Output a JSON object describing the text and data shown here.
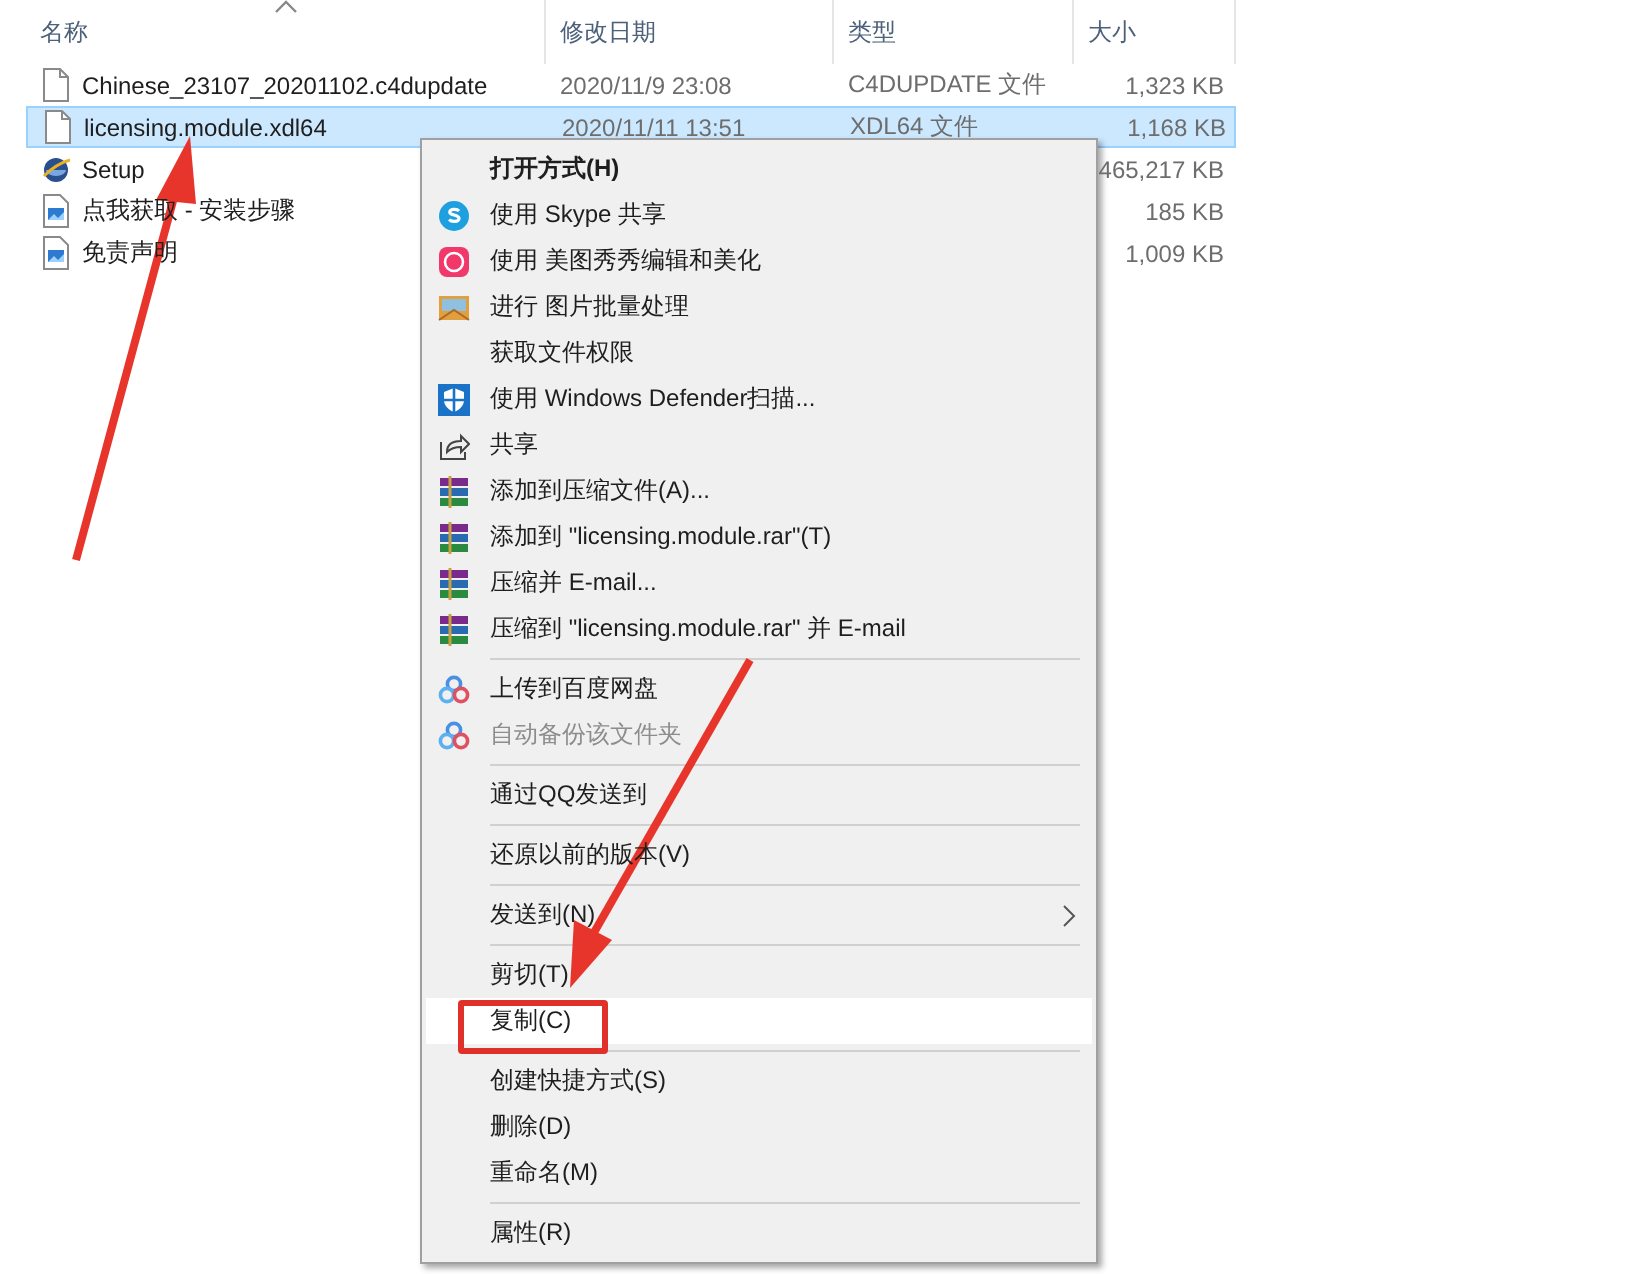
{
  "file_list": {
    "columns": [
      {
        "label": "名称",
        "sorted": true
      },
      {
        "label": "修改日期",
        "sorted": false
      },
      {
        "label": "类型",
        "sorted": false
      },
      {
        "label": "大小",
        "sorted": false
      }
    ],
    "files": [
      {
        "name": "Chinese_23107_20201102.c4dupdate",
        "kind": "document",
        "date": "2020/11/9 23:08",
        "type": "C4DUPDATE 文件",
        "size": "1,323 KB",
        "selected": false
      },
      {
        "name": "licensing.module.xdl64",
        "kind": "document",
        "date": "2020/11/11 13:51",
        "type": "XDL64 文件",
        "size": "1,168 KB",
        "selected": true
      },
      {
        "name": "Setup",
        "kind": "program",
        "size": "465,217 KB",
        "selected": false
      },
      {
        "name": "点我获取 - 安装步骤",
        "kind": "image",
        "size": "185 KB",
        "selected": false
      },
      {
        "name": "免责声明",
        "kind": "image",
        "size": "1,009 KB",
        "selected": false
      }
    ]
  },
  "context_menu": {
    "items": [
      {
        "kind": "item",
        "label": "打开方式(H)",
        "bold": true,
        "selected": false
      },
      {
        "kind": "item",
        "label": "使用 Skype 共享",
        "selected": false
      },
      {
        "kind": "item",
        "label": "使用 美图秀秀编辑和美化",
        "selected": false
      },
      {
        "kind": "item",
        "label": "进行 图片批量处理",
        "selected": false
      },
      {
        "kind": "item",
        "label": "获取文件权限",
        "selected": false
      },
      {
        "kind": "item",
        "label": "使用 Windows Defender扫描...",
        "selected": false
      },
      {
        "kind": "item",
        "label": "共享",
        "selected": false
      },
      {
        "kind": "item",
        "label": "添加到压缩文件(A)...",
        "selected": false
      },
      {
        "kind": "item",
        "label": "添加到 \"licensing.module.rar\"(T)",
        "selected": false
      },
      {
        "kind": "item",
        "label": "压缩并 E-mail...",
        "selected": false
      },
      {
        "kind": "item",
        "label": "压缩到 \"licensing.module.rar\" 并 E-mail",
        "selected": false
      },
      {
        "kind": "separator"
      },
      {
        "kind": "item",
        "label": "上传到百度网盘",
        "selected": false
      },
      {
        "kind": "item",
        "label": "自动备份该文件夹",
        "disabled": true,
        "selected": false
      },
      {
        "kind": "separator"
      },
      {
        "kind": "item",
        "label": "通过QQ发送到",
        "selected": false
      },
      {
        "kind": "separator"
      },
      {
        "kind": "item",
        "label": "还原以前的版本(V)",
        "selected": false
      },
      {
        "kind": "separator"
      },
      {
        "kind": "item",
        "label": "发送到(N)",
        "submenu": true,
        "selected": false
      },
      {
        "kind": "separator"
      },
      {
        "kind": "item",
        "label": "剪切(T)",
        "selected": false
      },
      {
        "kind": "item",
        "label": "复制(C)",
        "selected": true
      },
      {
        "kind": "separator"
      },
      {
        "kind": "item",
        "label": "创建快捷方式(S)",
        "selected": false
      },
      {
        "kind": "item",
        "label": "删除(D)",
        "selected": false
      },
      {
        "kind": "item",
        "label": "重命名(M)",
        "selected": false
      },
      {
        "kind": "separator"
      },
      {
        "kind": "item",
        "label": "属性(R)",
        "selected": false
      }
    ]
  }
}
